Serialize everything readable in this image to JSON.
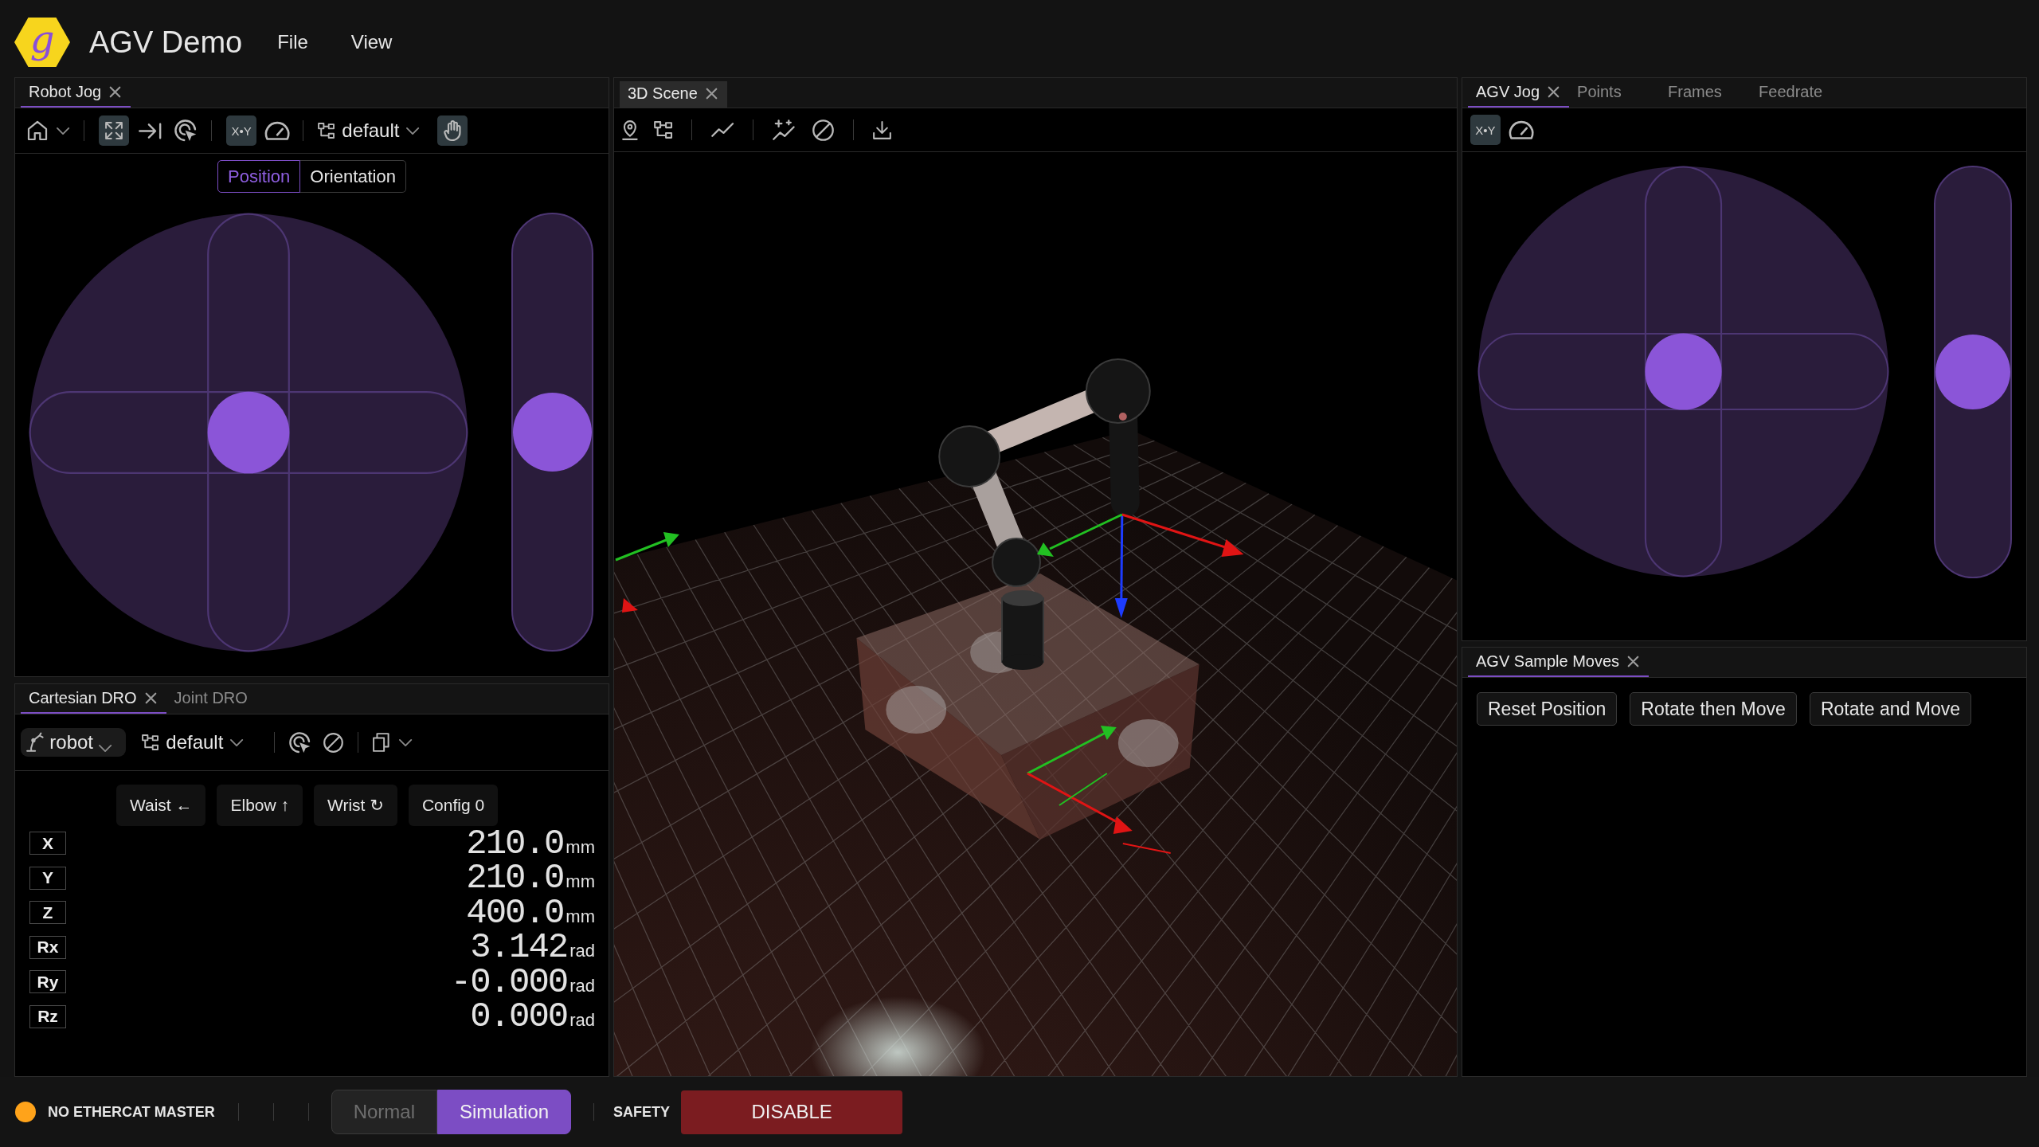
{
  "header": {
    "logo": "g",
    "title": "AGV Demo",
    "menu": [
      "File",
      "View"
    ]
  },
  "robot_jog": {
    "focused": true,
    "tabs": [
      {
        "label": "Robot Jog",
        "selected": true,
        "closable": true
      }
    ],
    "toolbar": {
      "expand_toggle": {
        "on": true
      },
      "xy_toggle": {
        "label": "X•Y",
        "on": true
      },
      "frame_select": {
        "value": "default"
      },
      "hand_toggle": {
        "on": true
      }
    },
    "mode_tabs": [
      {
        "label": "Position",
        "selected": true
      },
      {
        "label": "Orientation",
        "selected": false
      }
    ],
    "vertical_slider": {
      "level": 0.5
    }
  },
  "cartesian_dro": {
    "focused": true,
    "tabs": [
      {
        "label": "Cartesian DRO",
        "selected": true,
        "closable": true
      },
      {
        "label": "Joint DRO",
        "selected": false,
        "closable": false
      }
    ],
    "toolbar": {
      "robot_select": {
        "value": "robot"
      },
      "frame_select": {
        "value": "default"
      }
    },
    "config_buttons": [
      "Waist ←",
      "Elbow ↑",
      "Wrist ↻",
      "Config 0"
    ],
    "rows": [
      {
        "axis": "X",
        "value": "210.0",
        "unit": "mm"
      },
      {
        "axis": "Y",
        "value": "210.0",
        "unit": "mm"
      },
      {
        "axis": "Z",
        "value": "400.0",
        "unit": "mm"
      },
      {
        "axis": "Rx",
        "value": "3.142",
        "unit": "rad"
      },
      {
        "axis": "Ry",
        "value": "-0.000",
        "unit": "rad"
      },
      {
        "axis": "Rz",
        "value": "0.000",
        "unit": "rad"
      }
    ]
  },
  "scene": {
    "focused": false,
    "tabs": [
      {
        "label": "3D Scene",
        "selected": true,
        "closable": true
      }
    ]
  },
  "agv_jog": {
    "focused": true,
    "tabs": [
      {
        "label": "AGV Jog",
        "selected": true,
        "closable": true
      },
      {
        "label": "Points",
        "selected": false,
        "closable": false
      },
      {
        "label": "Frames",
        "selected": false,
        "closable": false
      },
      {
        "label": "Feedrate",
        "selected": false,
        "closable": false
      }
    ],
    "toolbar": {
      "xy_toggle": {
        "label": "X•Y",
        "on": true
      }
    },
    "vertical_slider": {
      "level": 0.5
    }
  },
  "agv_sample_moves": {
    "focused": true,
    "tabs": [
      {
        "label": "AGV Sample Moves",
        "selected": true,
        "closable": true
      }
    ],
    "buttons": [
      "Reset Position",
      "Rotate then Move",
      "Rotate and Move"
    ]
  },
  "status_bar": {
    "connection": {
      "label": "NO ETHERCAT MASTER",
      "color": "#ffa31a"
    },
    "mode": [
      {
        "label": "Normal",
        "selected": false
      },
      {
        "label": "Simulation",
        "selected": true
      }
    ],
    "safety_label": "SAFETY",
    "disable_button": "DISABLE"
  }
}
